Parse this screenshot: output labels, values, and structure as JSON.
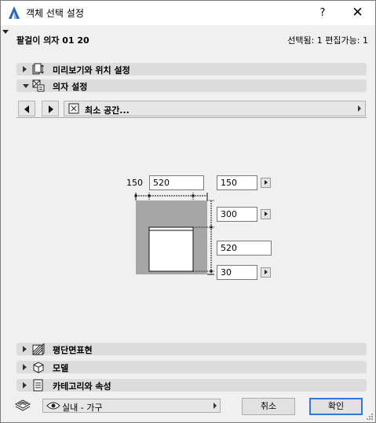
{
  "window": {
    "title": "객체 선택 설정",
    "help_label": "?",
    "close_label": "✕",
    "icon": "archicad-logo-icon"
  },
  "header": {
    "object_name": "팔걸이 의자 01 20",
    "selection_info": "선택됨: 1 편집가능: 1"
  },
  "panels_top": [
    {
      "label": "미리보기와 위치 설정",
      "icon": "preview-position-icon",
      "expanded": false
    },
    {
      "label": "의자 설정",
      "icon": "chair-settings-icon",
      "expanded": true
    }
  ],
  "page_nav": {
    "prev_icon": "arrow-left-icon",
    "next_icon": "arrow-right-icon",
    "current_page": "최소 공간...",
    "page_icon": "min-space-icon"
  },
  "dimensions": {
    "left_label": "150",
    "top_width": "520",
    "top_right": "150",
    "right_top": "300",
    "right_middle": "520",
    "right_bottom": "30"
  },
  "panels_bottom": [
    {
      "label": "평단면표현",
      "icon": "floor-plan-icon"
    },
    {
      "label": "모델",
      "icon": "model-cube-icon"
    },
    {
      "label": "카테고리와 속성",
      "icon": "category-list-icon"
    }
  ],
  "footer": {
    "layer_icon": "layers-icon",
    "layer_value": "실내 - 가구",
    "cancel_label": "취소",
    "ok_label": "확인"
  },
  "colors": {
    "panel_bg": "#dcdcdc",
    "dialog_bg": "#f0f0f0",
    "clearance_gray": "#a6a6a6",
    "ok_border": "#2f7ad6",
    "logo_blue": "#2c64b4"
  }
}
